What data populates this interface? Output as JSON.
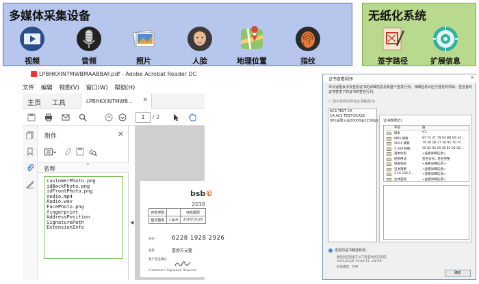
{
  "left_panel": {
    "title": "多媒体采集设备",
    "items": [
      {
        "label": "视频",
        "icon": "video-icon"
      },
      {
        "label": "音频",
        "icon": "microphone-icon"
      },
      {
        "label": "照片",
        "icon": "photos-icon"
      },
      {
        "label": "人脸",
        "icon": "face-icon"
      },
      {
        "label": "地理位置",
        "icon": "map-icon"
      },
      {
        "label": "指纹",
        "icon": "fingerprint-icon"
      }
    ]
  },
  "right_panel": {
    "title": "无纸化系统",
    "items": [
      {
        "label": "签字路径",
        "icon": "signature-icon"
      },
      {
        "label": "扩展信息",
        "icon": "disc-settings-icon"
      }
    ]
  },
  "acrobat": {
    "window_title": "LPBHKXINTMWBMAABBAF.pdf - Adobe Acrobat Reader DC",
    "menu": [
      "文件",
      "编辑",
      "视图(V)",
      "窗口(W)",
      "帮助(H)"
    ],
    "tabs": {
      "home": "主页",
      "tools": "工具",
      "doc": "LPBHKXINTMWB..."
    },
    "page": {
      "current": "1",
      "total": "/ 2"
    },
    "attachments": {
      "header": "附件",
      "column_name": "名称",
      "files": [
        "customerPhoto.png",
        "idBackPhoto.png",
        "idFrontPhoto.png",
        "Vedio.mp4",
        "Audio.wav",
        "FacePhoto.png",
        "fingerprint",
        "AddressPosition",
        "SignaturePath",
        "ExtensionInfo"
      ]
    },
    "document": {
      "brand": "bsb",
      "year": "2016",
      "table_row1": [
        "存款类别",
        "",
        "存款期限",
        ""
      ],
      "table_row2": [
        "整存整取",
        "人民币",
        "2016/10/26"
      ],
      "account": "6228 1928 2926",
      "amount": "壹拾万元整",
      "account_label": "账号",
      "amount_label": "金额",
      "signature_label": "客户签名确认",
      "signature_label_en": "Customer's Signature Required"
    }
  },
  "certificate": {
    "title": "证书查看程序",
    "description": "本对话框会涉及查看证书的详细信息及其整个签发行列。详细信息对应于选定的项目。签名者的证书签发了的证书的签名行列。",
    "checkbox": "显示找到的所有证书路径(S)",
    "tree": [
      "ACS TEST CA",
      "CA ACS TEST-OCA32",
      "001@张三@20000@2230@2"
    ],
    "tabs": [
      "小结",
      "详细信息",
      "吊销",
      "信任",
      "策略",
      "法"
    ],
    "active_tab": 1,
    "fields_label": "证书数据(E):",
    "field_headers": [
      "字段",
      "值"
    ],
    "fields": [
      {
        "name": "版本",
        "value": "V3"
      },
      {
        "name": "MD5 摘要",
        "value": "87 74 2C 79 93 BB D6 34 ..."
      },
      {
        "name": "SHA1 摘要",
        "value": "79 39 D6 17 38 92 7D 7C ..."
      },
      {
        "name": "X.509 数据",
        "value": "30 82 04 20 30 82 03 08 ..."
      },
      {
        "name": "基本约束",
        "value": "<查看详细信息>"
      },
      {
        "name": "密钥用法",
        "value": "签名证书，签名完整"
      },
      {
        "name": "颁发机构",
        "value": "<查看详细信息>"
      },
      {
        "name": "证书策略",
        "value": "<查看详细信息>"
      },
      {
        "name": "2.16.156.1...",
        "value": "<查看详细信息>"
      },
      {
        "name": "主体密钥",
        "value": "<查看详细信息>"
      }
    ],
    "status": "选定的证书路径有效。",
    "validity_line1": "路径验证检查于以下签名时间已完成：",
    "validity_line2": "2016/10/26 15:44:11 +08'00'",
    "validity_line3": "验证模型：外壳",
    "ok_button": "确定"
  }
}
